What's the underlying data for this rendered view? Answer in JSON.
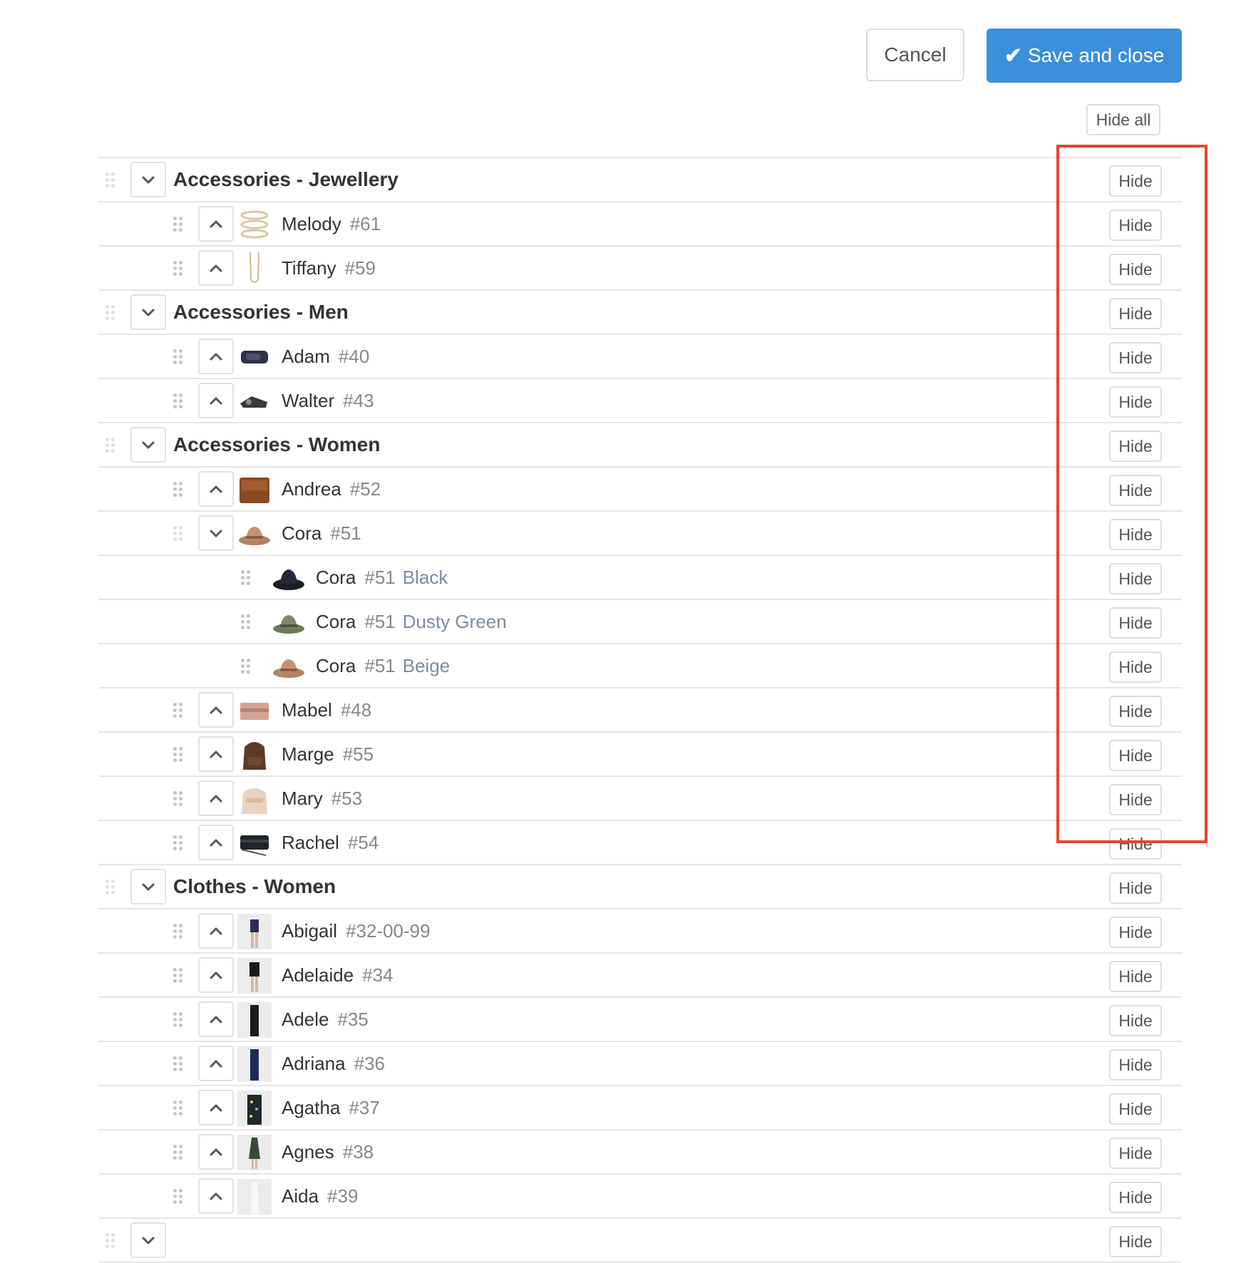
{
  "toolbar": {
    "cancel_label": "Cancel",
    "save_label": "Save and close",
    "hide_all_label": "Hide all"
  },
  "hide_label": "Hide",
  "colors": {
    "accent": "#3b8fdb",
    "highlight": "#e8442f"
  },
  "rows": [
    {
      "level": 0,
      "type": "category",
      "name": "Accessories - Jewellery",
      "toggle": "down"
    },
    {
      "level": 1,
      "type": "product",
      "name": "Melody",
      "num": "#61",
      "toggle": "up",
      "thumb": "bracelet"
    },
    {
      "level": 1,
      "type": "product",
      "name": "Tiffany",
      "num": "#59",
      "toggle": "up",
      "thumb": "necklace"
    },
    {
      "level": 0,
      "type": "category",
      "name": "Accessories - Men",
      "toggle": "down"
    },
    {
      "level": 1,
      "type": "product",
      "name": "Adam",
      "num": "#40",
      "toggle": "up",
      "thumb": "wallet"
    },
    {
      "level": 1,
      "type": "product",
      "name": "Walter",
      "num": "#43",
      "toggle": "up",
      "thumb": "belt"
    },
    {
      "level": 0,
      "type": "category",
      "name": "Accessories - Women",
      "toggle": "down"
    },
    {
      "level": 1,
      "type": "product",
      "name": "Andrea",
      "num": "#52",
      "toggle": "up",
      "thumb": "bag-brown"
    },
    {
      "level": 1,
      "type": "product",
      "name": "Cora",
      "num": "#51",
      "toggle": "down",
      "thumb": "hat-beige",
      "faded": true
    },
    {
      "level": 2,
      "type": "variant",
      "name": "Cora",
      "num": "#51",
      "variant": "Black",
      "thumb": "hat-black"
    },
    {
      "level": 2,
      "type": "variant",
      "name": "Cora",
      "num": "#51",
      "variant": "Dusty Green",
      "thumb": "hat-green"
    },
    {
      "level": 2,
      "type": "variant",
      "name": "Cora",
      "num": "#51",
      "variant": "Beige",
      "thumb": "hat-beige"
    },
    {
      "level": 1,
      "type": "product",
      "name": "Mabel",
      "num": "#48",
      "toggle": "up",
      "thumb": "clutch-pink"
    },
    {
      "level": 1,
      "type": "product",
      "name": "Marge",
      "num": "#55",
      "toggle": "up",
      "thumb": "backpack-brown"
    },
    {
      "level": 1,
      "type": "product",
      "name": "Mary",
      "num": "#53",
      "toggle": "up",
      "thumb": "backpack-beige"
    },
    {
      "level": 1,
      "type": "product",
      "name": "Rachel",
      "num": "#54",
      "toggle": "up",
      "thumb": "bag-black"
    },
    {
      "level": 0,
      "type": "category",
      "name": "Clothes - Women",
      "toggle": "down"
    },
    {
      "level": 1,
      "type": "product",
      "name": "Abigail",
      "num": "#32-00-99",
      "toggle": "up",
      "thumb": "model-shorts"
    },
    {
      "level": 1,
      "type": "product",
      "name": "Adelaide",
      "num": "#34",
      "toggle": "up",
      "thumb": "model-skirt"
    },
    {
      "level": 1,
      "type": "product",
      "name": "Adele",
      "num": "#35",
      "toggle": "up",
      "thumb": "model-black"
    },
    {
      "level": 1,
      "type": "product",
      "name": "Adriana",
      "num": "#36",
      "toggle": "up",
      "thumb": "model-jeans"
    },
    {
      "level": 1,
      "type": "product",
      "name": "Agatha",
      "num": "#37",
      "toggle": "up",
      "thumb": "model-floral"
    },
    {
      "level": 1,
      "type": "product",
      "name": "Agnes",
      "num": "#38",
      "toggle": "up",
      "thumb": "model-dress"
    },
    {
      "level": 1,
      "type": "product",
      "name": "Aida",
      "num": "#39",
      "toggle": "up",
      "thumb": "model-white"
    },
    {
      "level": 0,
      "type": "category",
      "name": "",
      "toggle": "down"
    }
  ]
}
